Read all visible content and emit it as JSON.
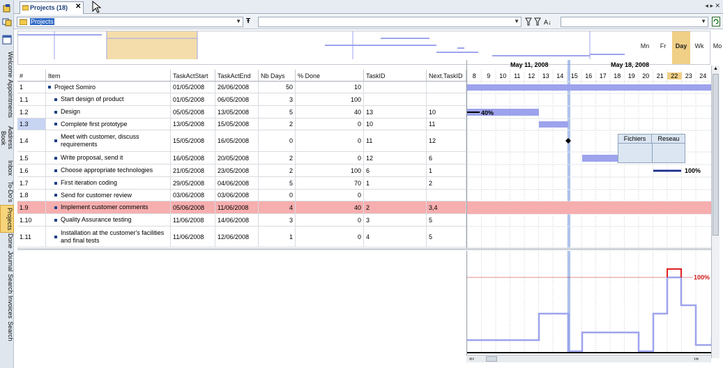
{
  "tab": {
    "title": "Projects (18)",
    "close": "✕"
  },
  "nav": {
    "arrows": "◂ ▸ ✕"
  },
  "filter": {
    "selected": "Projects",
    "funnel": "Ŧ"
  },
  "zoom": [
    {
      "label": "Mn",
      "active": false
    },
    {
      "label": "Fr",
      "active": false
    },
    {
      "label": "Day",
      "active": true
    },
    {
      "label": "Wk",
      "active": false
    },
    {
      "label": "Mo",
      "active": false
    }
  ],
  "sidebar": {
    "tabs": [
      "Welcome",
      "Appointments",
      "Address Book",
      "Inbox",
      "To-Do's",
      "Projects",
      "Done",
      "Journal",
      "Search",
      "Invoices",
      "Search"
    ],
    "active": 5
  },
  "columns": [
    "#",
    "Item",
    "TaskActStart",
    "TaskActEnd",
    "Nb Days",
    "% Done",
    "TaskID",
    "Next.TaskID"
  ],
  "rows": [
    {
      "num": "1",
      "item": "Project Somiro",
      "start": "01/05/2008",
      "end": "26/06/2008",
      "days": "50",
      "done": "10",
      "id": "",
      "next": "",
      "level": 0
    },
    {
      "num": "1.1",
      "item": "Start design of product",
      "start": "01/05/2008",
      "end": "06/05/2008",
      "days": "3",
      "done": "100",
      "id": "",
      "next": "",
      "level": 1
    },
    {
      "num": "1.2",
      "item": "Design",
      "start": "05/05/2008",
      "end": "13/05/2008",
      "days": "5",
      "done": "40",
      "id": "13",
      "next": "10",
      "level": 1
    },
    {
      "num": "1.3",
      "item": "Complete first prototype",
      "start": "13/05/2008",
      "end": "15/05/2008",
      "days": "2",
      "done": "0",
      "id": "10",
      "next": "11",
      "level": 1
    },
    {
      "num": "1.4",
      "item": "Meet with customer, discuss requirements",
      "start": "15/05/2008",
      "end": "16/05/2008",
      "days": "0",
      "done": "0",
      "id": "11",
      "next": "12",
      "level": 1
    },
    {
      "num": "1.5",
      "item": "Write proposal, send it",
      "start": "16/05/2008",
      "end": "20/05/2008",
      "days": "2",
      "done": "0",
      "id": "12",
      "next": "6",
      "level": 1
    },
    {
      "num": "1.6",
      "item": "Choose appropriate technologies",
      "start": "21/05/2008",
      "end": "23/05/2008",
      "days": "2",
      "done": "100",
      "id": "6",
      "next": "1",
      "level": 1
    },
    {
      "num": "1.7",
      "item": "First iteration coding",
      "start": "29/05/2008",
      "end": "04/06/2008",
      "days": "5",
      "done": "70",
      "id": "1",
      "next": "2",
      "level": 1
    },
    {
      "num": "1.8",
      "item": "Send for customer review",
      "start": "03/06/2008",
      "end": "03/06/2008",
      "days": "0",
      "done": "0",
      "id": "",
      "next": "",
      "level": 1
    },
    {
      "num": "1.9",
      "item": "Implement customer comments",
      "start": "05/06/2008",
      "end": "11/06/2008",
      "days": "4",
      "done": "40",
      "id": "2",
      "next": "3,4",
      "level": 1
    },
    {
      "num": "1.10",
      "item": "Quality Assurance testing",
      "start": "11/06/2008",
      "end": "14/06/2008",
      "days": "3",
      "done": "0",
      "id": "3",
      "next": "5",
      "level": 1
    },
    {
      "num": "1.11",
      "item": "Installation at the customer's facilities and final tests",
      "start": "11/06/2008",
      "end": "12/06/2008",
      "days": "1",
      "done": "0",
      "id": "4",
      "next": "5",
      "level": 1
    }
  ],
  "gantt": {
    "week1": "May 11, 2008",
    "week2": "May 18, 2008",
    "days": [
      "8",
      "9",
      "10",
      "11",
      "12",
      "13",
      "14",
      "15",
      "16",
      "17",
      "18",
      "19",
      "20",
      "21",
      "22",
      "23",
      "24"
    ],
    "label_design": "40%",
    "label_tech": "100%",
    "popup_col1": "Fichiers",
    "popup_col2": "Reseau"
  },
  "histogram": {
    "threshold_label": "100%"
  },
  "colors": {
    "bar": "#9da3ec",
    "highlight": "#f6aeae",
    "overload": "#e02020"
  }
}
